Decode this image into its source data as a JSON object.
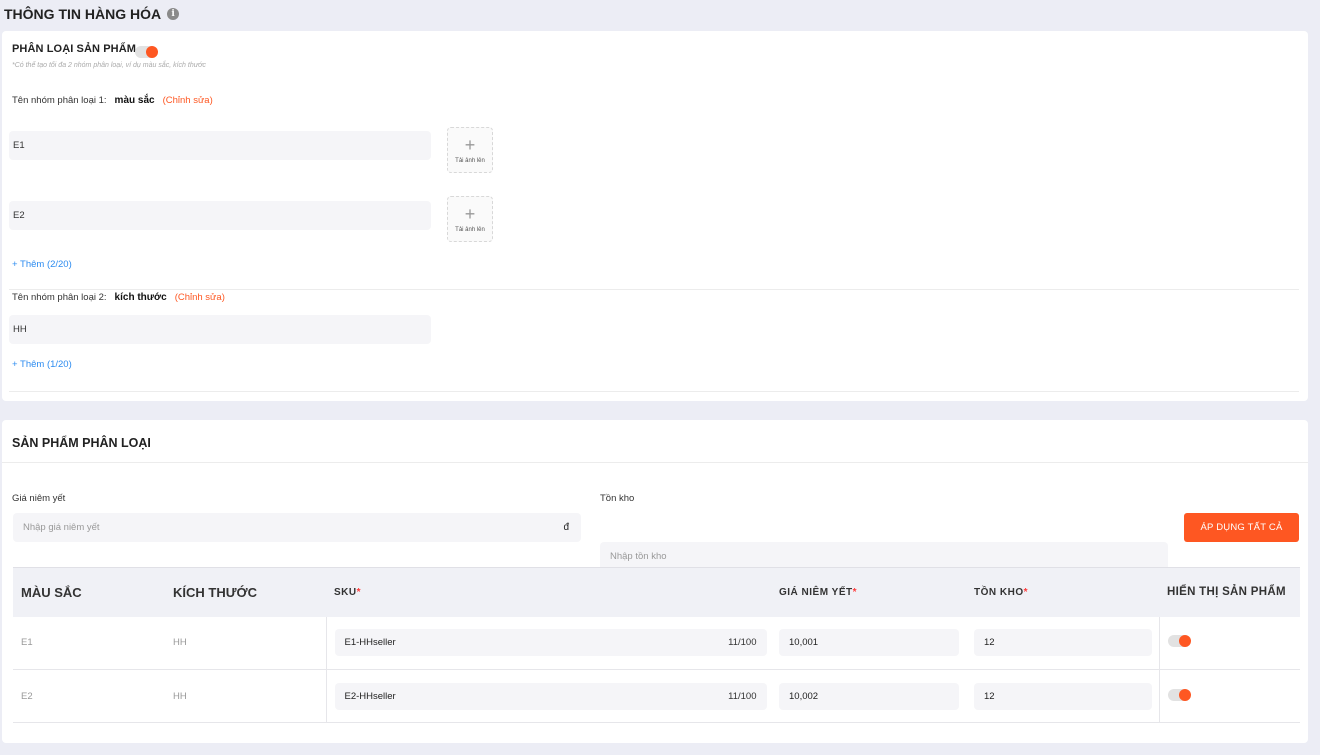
{
  "header": {
    "title": "THÔNG TIN HÀNG HÓA",
    "info_icon": "i"
  },
  "classification": {
    "label": "PHÂN LOẠI SẢN PHẨM",
    "hint": "*Có thể tạo tối đa 2 nhóm phân loại, ví dụ màu sắc, kích thước",
    "toggle_on": true,
    "edit_label": "(Chỉnh sửa)",
    "upload_label": "Tải ảnh lên",
    "groups": [
      {
        "title_label": "Tên nhóm phân loại 1:",
        "name": "màu sắc",
        "options": [
          "E1",
          "E2"
        ],
        "add_label": "+ Thêm (2/20)"
      },
      {
        "title_label": "Tên nhóm phân loại 2:",
        "name": "kích thước",
        "options": [
          "HH"
        ],
        "add_label": "+ Thêm (1/20)"
      }
    ]
  },
  "variants": {
    "title": "SẢN PHẨM PHÂN LOẠI",
    "price_label": "Giá niêm yết",
    "price_placeholder": "Nhập giá niêm yết",
    "currency": "đ",
    "stock_label": "Tồn kho",
    "stock_placeholder": "Nhập tồn kho",
    "apply_all_label": "ÁP DỤNG TẤT CẢ",
    "columns": {
      "color": "MÀU SẮC",
      "size": "KÍCH THƯỚC",
      "sku": "SKU",
      "price": "GIÁ NIÊM YẾT",
      "stock": "TỒN KHO",
      "visible": "HIỂN THỊ SẢN PHẨM",
      "required_mark": "*"
    },
    "rows": [
      {
        "color": "E1",
        "size": "HH",
        "sku": "E1-HHseller",
        "sku_count": "11/100",
        "price": "10,001",
        "stock": "12",
        "visible": true
      },
      {
        "color": "E2",
        "size": "HH",
        "sku": "E2-HHseller",
        "sku_count": "11/100",
        "price": "10,002",
        "stock": "12",
        "visible": true
      }
    ]
  },
  "colors": {
    "accent": "#fe5722",
    "link": "#2d8cf0",
    "page_bg": "#ecedf5"
  }
}
